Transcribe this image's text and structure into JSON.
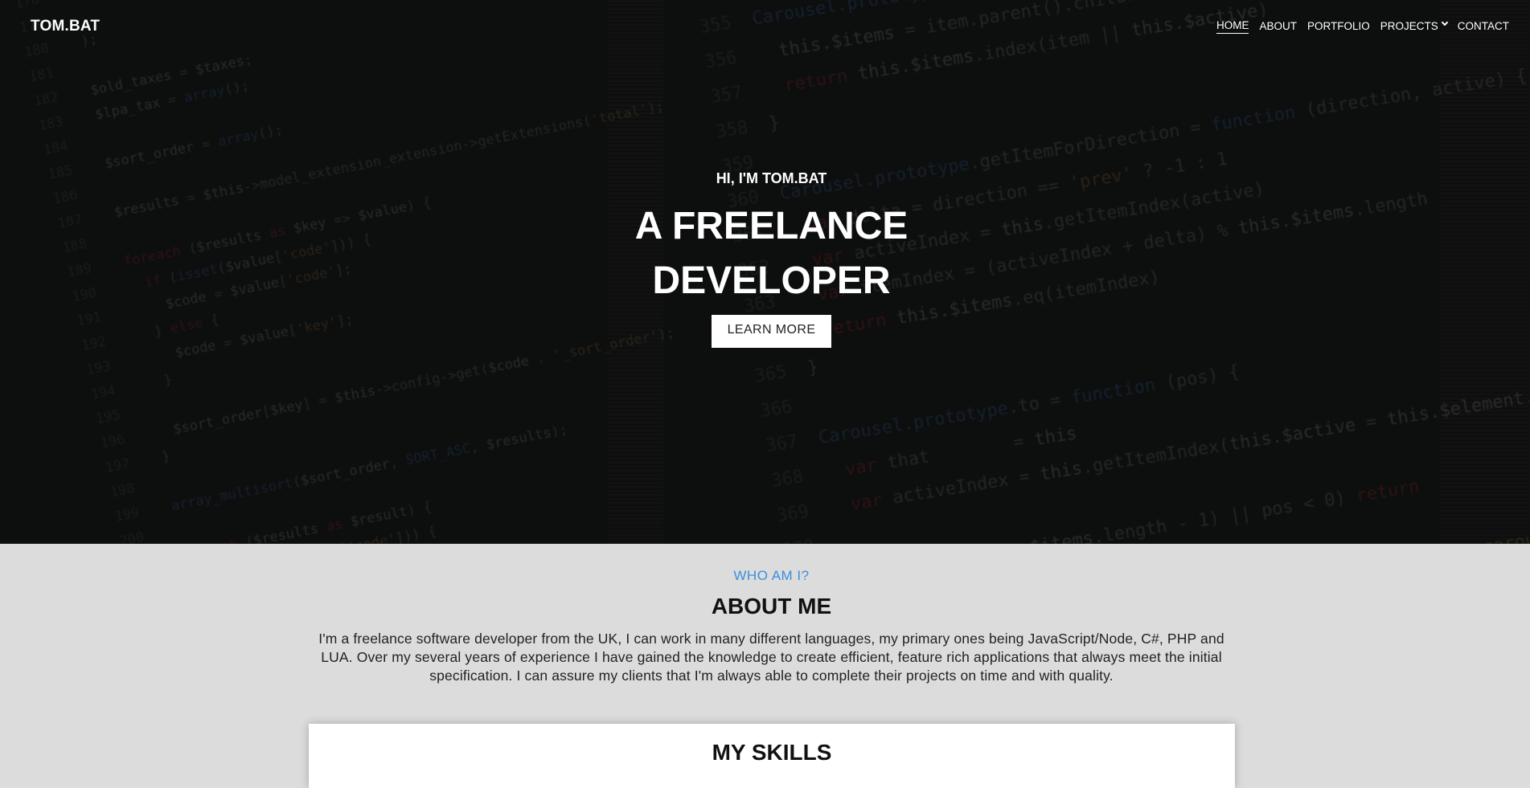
{
  "nav": {
    "brand": "TOM.BAT",
    "items": [
      {
        "label": "HOME"
      },
      {
        "label": "ABOUT"
      },
      {
        "label": "PORTFOLIO"
      },
      {
        "label": "PROJECTS"
      },
      {
        "label": "CONTACT"
      }
    ]
  },
  "hero": {
    "greeting": "HI, I'M TOM.BAT",
    "title_line1": "A FREELANCE",
    "title_line2": "DEVELOPER",
    "button_label": "LEARN MORE"
  },
  "about": {
    "kicker": "WHO AM I?",
    "title": "ABOUT ME",
    "text": "I'm a freelance software developer from the UK, I can work in many different languages, my primary ones being JavaScript/Node, C#, PHP and LUA. Over my several years of experience I have gained the knowledge to create efficient, feature rich applications that always meet the initial specification. I can assure my clients that I'm always able to complete their projects on time and with quality."
  },
  "skills": {
    "title": "MY SKILLS"
  },
  "colors": {
    "accent": "#3b8fe0",
    "hero_bg": "#101112",
    "section_bg": "#dcdcdc"
  }
}
